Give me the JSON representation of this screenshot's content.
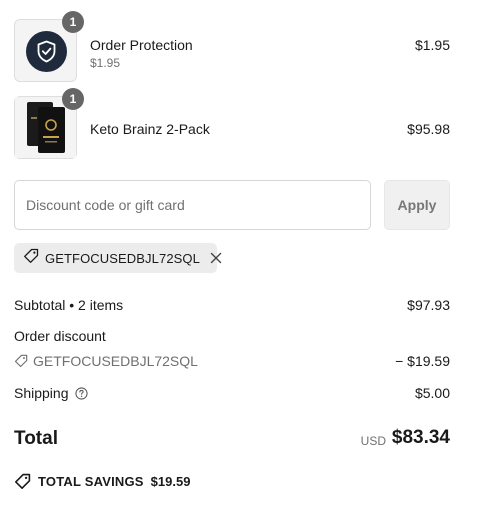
{
  "line_items": [
    {
      "name": "Order Protection",
      "subprice": "$1.95",
      "price": "$1.95",
      "quantity": "1",
      "thumbnail_icon": "shield-check-icon"
    },
    {
      "name": "Keto Brainz 2-Pack",
      "price": "$95.98",
      "quantity": "1",
      "thumbnail_icon": "product-pouches-image"
    }
  ],
  "discount": {
    "placeholder": "Discount code or gift card",
    "value": "",
    "apply_label": "Apply",
    "applied_code": "GETFOCUSEDBJL72SQL"
  },
  "summary": {
    "subtotal_label": "Subtotal • 2 items",
    "subtotal_value": "$97.93",
    "order_discount_label": "Order discount",
    "order_discount_code": "GETFOCUSEDBJL72SQL",
    "order_discount_value": "− $19.59",
    "shipping_label": "Shipping",
    "shipping_value": "$5.00",
    "total_label": "Total",
    "total_currency": "USD",
    "total_value": "$83.34",
    "total_savings_label": "TOTAL SAVINGS",
    "total_savings_value": "$19.59"
  },
  "colors": {
    "badge": "#666666",
    "shield_bg": "#1f2a3d",
    "chip_bg": "#ececec",
    "apply_bg": "#f0f0f0"
  }
}
